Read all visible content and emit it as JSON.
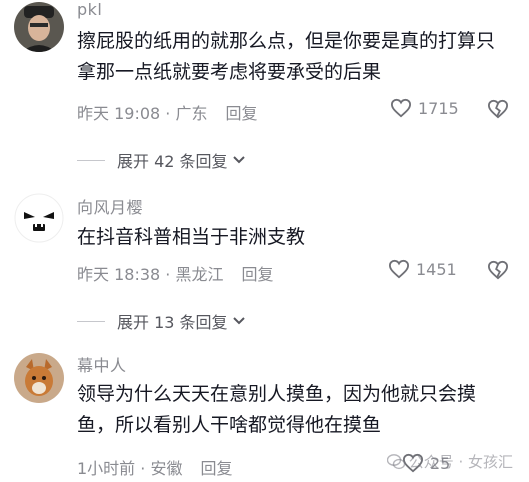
{
  "comments": [
    {
      "username": "pkl",
      "text": "擦屁股的纸用的就那么点，但是你要是真的打算只拿那一点纸就要考虑将要承受的后果",
      "meta": "昨天 19:08 · 广东",
      "reply_label": "回复",
      "likes": "1715",
      "expand_label": "展开 42 条回复"
    },
    {
      "username": "向风月樱",
      "text": "在抖音科普相当于非洲支教",
      "meta": "昨天 18:38 · 黑龙江",
      "reply_label": "回复",
      "likes": "1451",
      "expand_label": "展开 13 条回复"
    },
    {
      "username": "幕中人",
      "text": "领导为什么天天在意别人摸鱼，因为他就只会摸鱼，所以看别人干啥都觉得他在摸鱼",
      "meta": "1小时前 · 安徽",
      "reply_label": "回复",
      "likes": "25"
    }
  ],
  "watermark": "公众号 · 女孩汇",
  "icons": {
    "like": "heart-outline-icon",
    "dislike": "broken-heart-icon",
    "expand": "chevron-down-icon"
  },
  "colors": {
    "text_primary": "#161823",
    "text_secondary": "#8a8b91"
  }
}
